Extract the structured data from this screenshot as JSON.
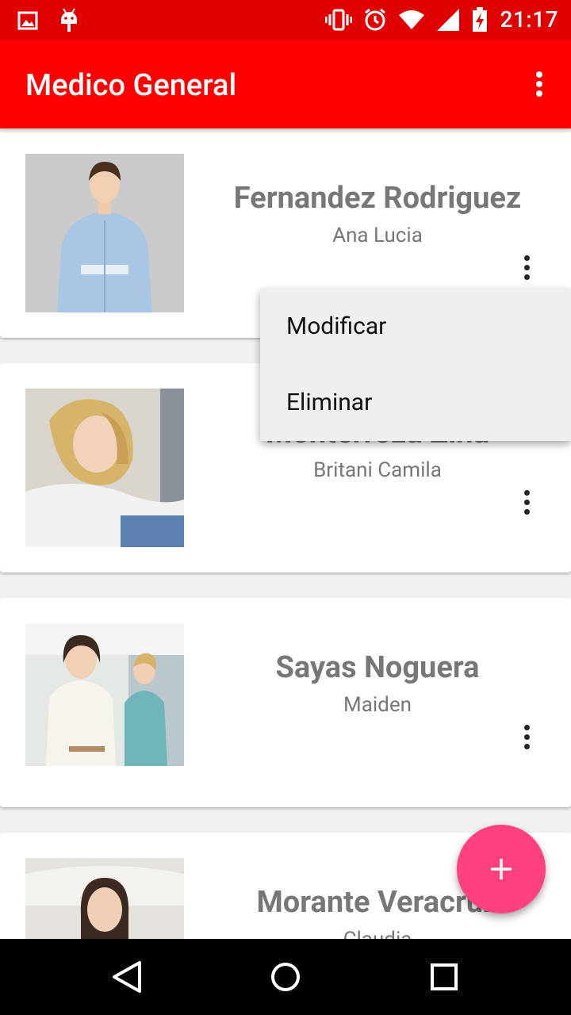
{
  "status_bar": {
    "time": "21:17",
    "left_icons": [
      "image-notification-icon",
      "android-debug-icon"
    ],
    "right_icons": [
      "vibrate-icon",
      "alarm-icon",
      "wifi-icon",
      "cell-signal-icon",
      "battery-charging-icon"
    ]
  },
  "app_bar": {
    "title": "Medico General",
    "menu_icon": "more-vert-icon"
  },
  "doctors": [
    {
      "surname": "Fernandez Rodriguez",
      "given_names": "Ana Lucia",
      "photo": "nurse-light-blue-uniform"
    },
    {
      "surname": "Monterroza Ziña",
      "given_names": "Britani Camila",
      "photo": "blonde-woman-in-hospital-bed"
    },
    {
      "surname": "Sayas Noguera",
      "given_names": "Maiden",
      "photo": "smiling-woman-in-hospital-ward"
    },
    {
      "surname": "Morante Veracruz",
      "given_names": "Claudia",
      "photo": "woman-in-hospital-bed"
    }
  ],
  "popup_menu": {
    "items": [
      "Modificar",
      "Eliminar"
    ]
  },
  "fab": {
    "icon": "plus-icon"
  },
  "nav_bar": {
    "icons": [
      "back-icon",
      "home-icon",
      "recents-icon"
    ]
  },
  "colors": {
    "status_bar": "#e00000",
    "app_bar": "#ff0000",
    "fab": "#ff4081",
    "text_secondary": "#777777"
  }
}
